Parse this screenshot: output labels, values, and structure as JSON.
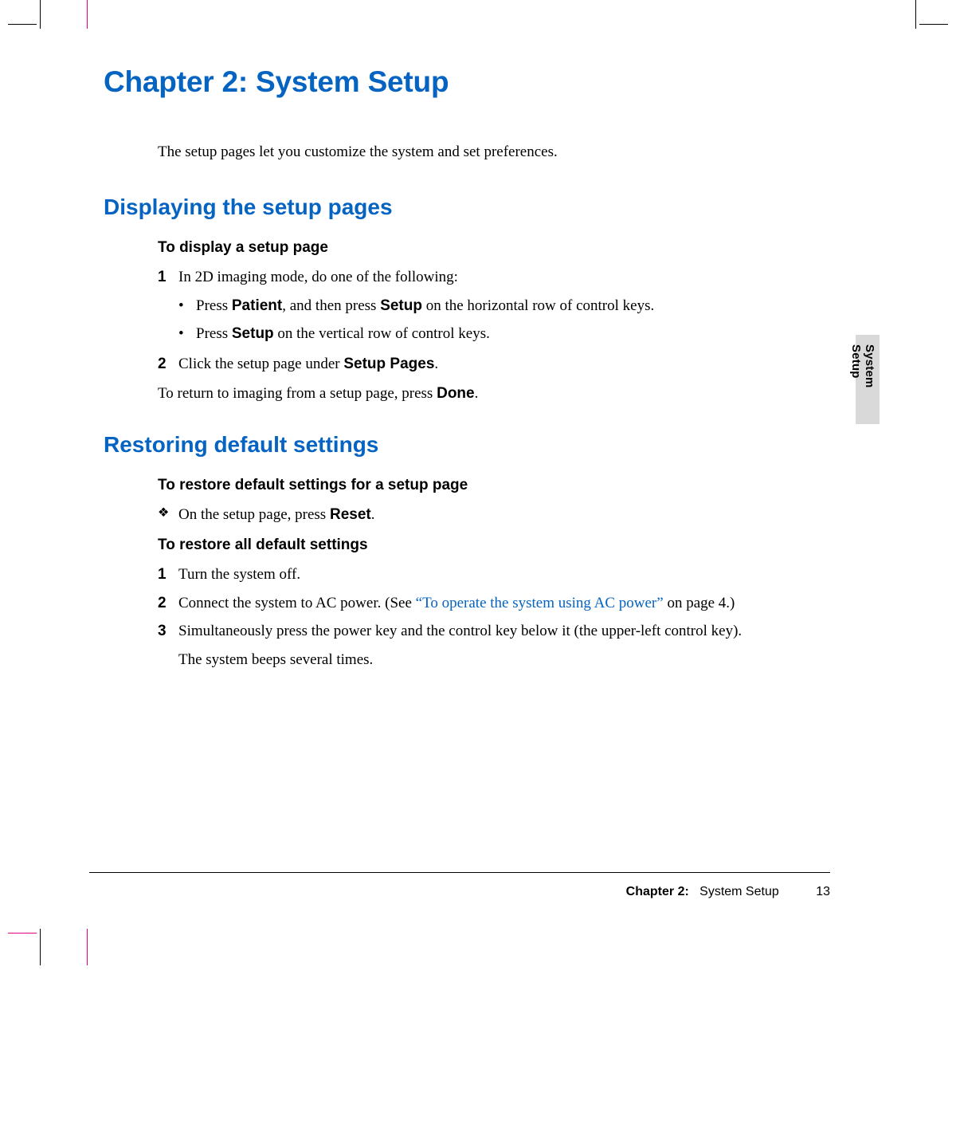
{
  "chapter_title": "Chapter 2: System Setup",
  "intro": "The setup pages let you customize the system and set preferences.",
  "section1": {
    "heading": "Displaying the setup pages",
    "h3": "To display a setup page",
    "step1_num": "1",
    "step1": "In 2D imaging mode, do one of the following:",
    "sub1_pre": "Press ",
    "sub1_b1": "Patient",
    "sub1_mid": ", and then press ",
    "sub1_b2": "Setup",
    "sub1_post": " on the horizontal row of control keys.",
    "sub2_pre": "Press ",
    "sub2_b1": "Setup",
    "sub2_post": " on the vertical row of control keys.",
    "step2_num": "2",
    "step2_pre": "Click the setup page under ",
    "step2_b": "Setup Pages",
    "step2_post": ".",
    "return_pre": "To return to imaging from a setup page, press ",
    "return_b": "Done",
    "return_post": "."
  },
  "section2": {
    "heading": "Restoring default settings",
    "h3a": "To restore default settings for a setup page",
    "clover_pre": "On the setup page, press ",
    "clover_b": "Reset",
    "clover_post": ".",
    "h3b": "To restore all default settings",
    "s1_num": "1",
    "s1": "Turn the system off.",
    "s2_num": "2",
    "s2_pre": "Connect the system to AC power. (See ",
    "s2_link": "“To operate the system using AC power”",
    "s2_post": " on page 4.)",
    "s3_num": "3",
    "s3": "Simultaneously press the power key and the control key below it (the upper-left control key).",
    "s3_after": "The system beeps several times."
  },
  "thumb_tab": "System Setup",
  "footer": {
    "chapter_label": "Chapter 2:",
    "chapter_name": "System Setup",
    "page": "13"
  }
}
